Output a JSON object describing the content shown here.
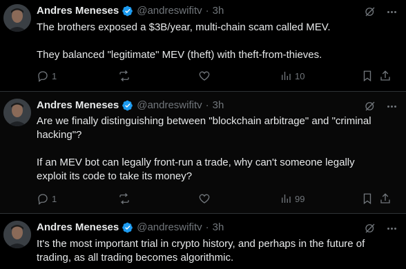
{
  "tweets": [
    {
      "name": "Andres Meneses",
      "handle": "@andreswifitv",
      "time": "3h",
      "lines": [
        "The brothers exposed a $3B/year, multi-chain scam called MEV.",
        "",
        "They balanced \"legitimate\" MEV (theft) with theft-from-thieves."
      ],
      "replies": "1",
      "reposts": "",
      "likes": "",
      "views": "10"
    },
    {
      "name": "Andres Meneses",
      "handle": "@andreswifitv",
      "time": "3h",
      "lines": [
        "Are we finally distinguishing between \"blockchain arbitrage\" and \"criminal",
        "hacking\"?",
        "",
        "If an MEV bot can legally front-run a trade, why can't someone legally",
        "exploit its code to take its money?"
      ],
      "replies": "1",
      "reposts": "",
      "likes": "",
      "views": "99"
    },
    {
      "name": "Andres Meneses",
      "handle": "@andreswifitv",
      "time": "3h",
      "lines": [
        "It's the most important trial in crypto history, and perhaps in the future of",
        "trading, as all trading becomes algorithmic."
      ]
    }
  ],
  "colors": {
    "background": "#000000",
    "text": "#e7e9ea",
    "muted": "#71767b",
    "verified": "#1d9bf0"
  },
  "icons": [
    "verified-badge-icon",
    "grok-icon",
    "more-icon",
    "reply-icon",
    "repost-icon",
    "like-icon",
    "views-icon",
    "bookmark-icon",
    "share-icon"
  ]
}
